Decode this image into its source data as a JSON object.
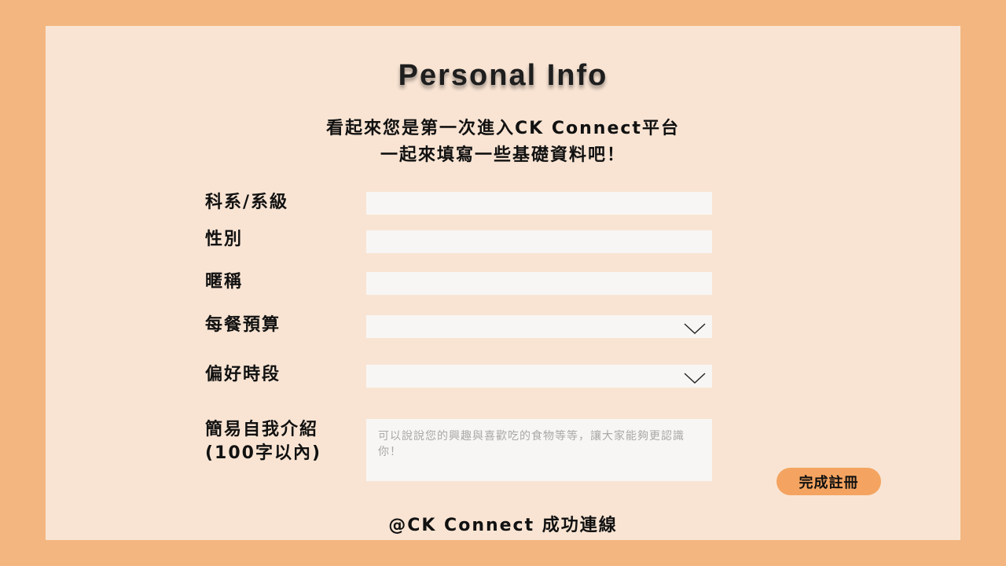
{
  "page": {
    "title": "Personal Info",
    "subtitle_line1": "看起來您是第一次進入CK Connect平台",
    "subtitle_line2": "一起來填寫一些基礎資料吧！"
  },
  "form": {
    "department": {
      "label": "科系/系級",
      "value": "",
      "placeholder": ""
    },
    "gender": {
      "label": "性別",
      "value": "",
      "placeholder": ""
    },
    "nickname": {
      "label": "暱稱",
      "value": "",
      "placeholder": ""
    },
    "budget": {
      "label": "每餐預算",
      "selected": "",
      "icon": "chevron-down-icon"
    },
    "time_slot": {
      "label": "偏好時段",
      "selected": "",
      "icon": "chevron-down-icon"
    },
    "intro": {
      "label_line1": "簡易自我介紹",
      "label_line2": "(100字以內)",
      "value": "",
      "placeholder": "可以說說您的興趣與喜歡吃的食物等等，讓大家能夠更認識你！"
    },
    "submit_label": "完成註冊"
  },
  "footer": {
    "status": "@CK Connect 成功連線"
  },
  "colors": {
    "background": "#f3b680",
    "card": "#f9e4d3",
    "field": "#f8f6f4",
    "button": "#f4a460"
  }
}
